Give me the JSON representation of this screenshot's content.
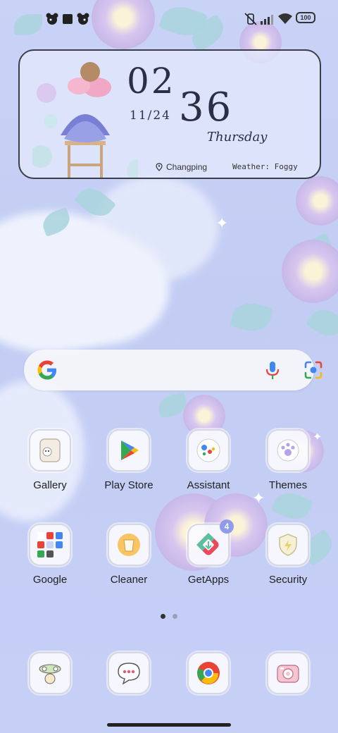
{
  "status_bar": {
    "battery": "100",
    "left_icons": [
      "mouse-face-icon",
      "square-icon",
      "mouse-face-icon"
    ],
    "right_icons": [
      "vibrate-off-icon",
      "signal-icon",
      "wifi-icon",
      "battery-icon"
    ]
  },
  "clock_widget": {
    "hour": "02",
    "minute": "36",
    "date": "11/24",
    "weekday": "Thursday",
    "location": "Changping",
    "weather": "Weather: Foggy"
  },
  "search_bar": {
    "icons": [
      "google-logo-icon",
      "microphone-icon",
      "lens-icon"
    ]
  },
  "apps": [
    {
      "label": "Gallery",
      "icon": "gallery-icon"
    },
    {
      "label": "Play Store",
      "icon": "play-store-icon"
    },
    {
      "label": "Assistant",
      "icon": "assistant-icon"
    },
    {
      "label": "Themes",
      "icon": "themes-icon"
    },
    {
      "label": "Google",
      "icon": "google-folder-icon"
    },
    {
      "label": "Cleaner",
      "icon": "cleaner-icon"
    },
    {
      "label": "GetApps",
      "icon": "getapps-icon",
      "badge": "4"
    },
    {
      "label": "Security",
      "icon": "security-icon"
    }
  ],
  "dock": [
    {
      "icon": "phone-icon"
    },
    {
      "icon": "messages-icon"
    },
    {
      "icon": "chrome-icon"
    },
    {
      "icon": "camera-icon"
    }
  ],
  "page_indicator": {
    "pages": 2,
    "current": 1
  },
  "colors": {
    "accent": "#8e9ceb",
    "text_dark": "#2b2f46",
    "background": "#c5cef5"
  }
}
